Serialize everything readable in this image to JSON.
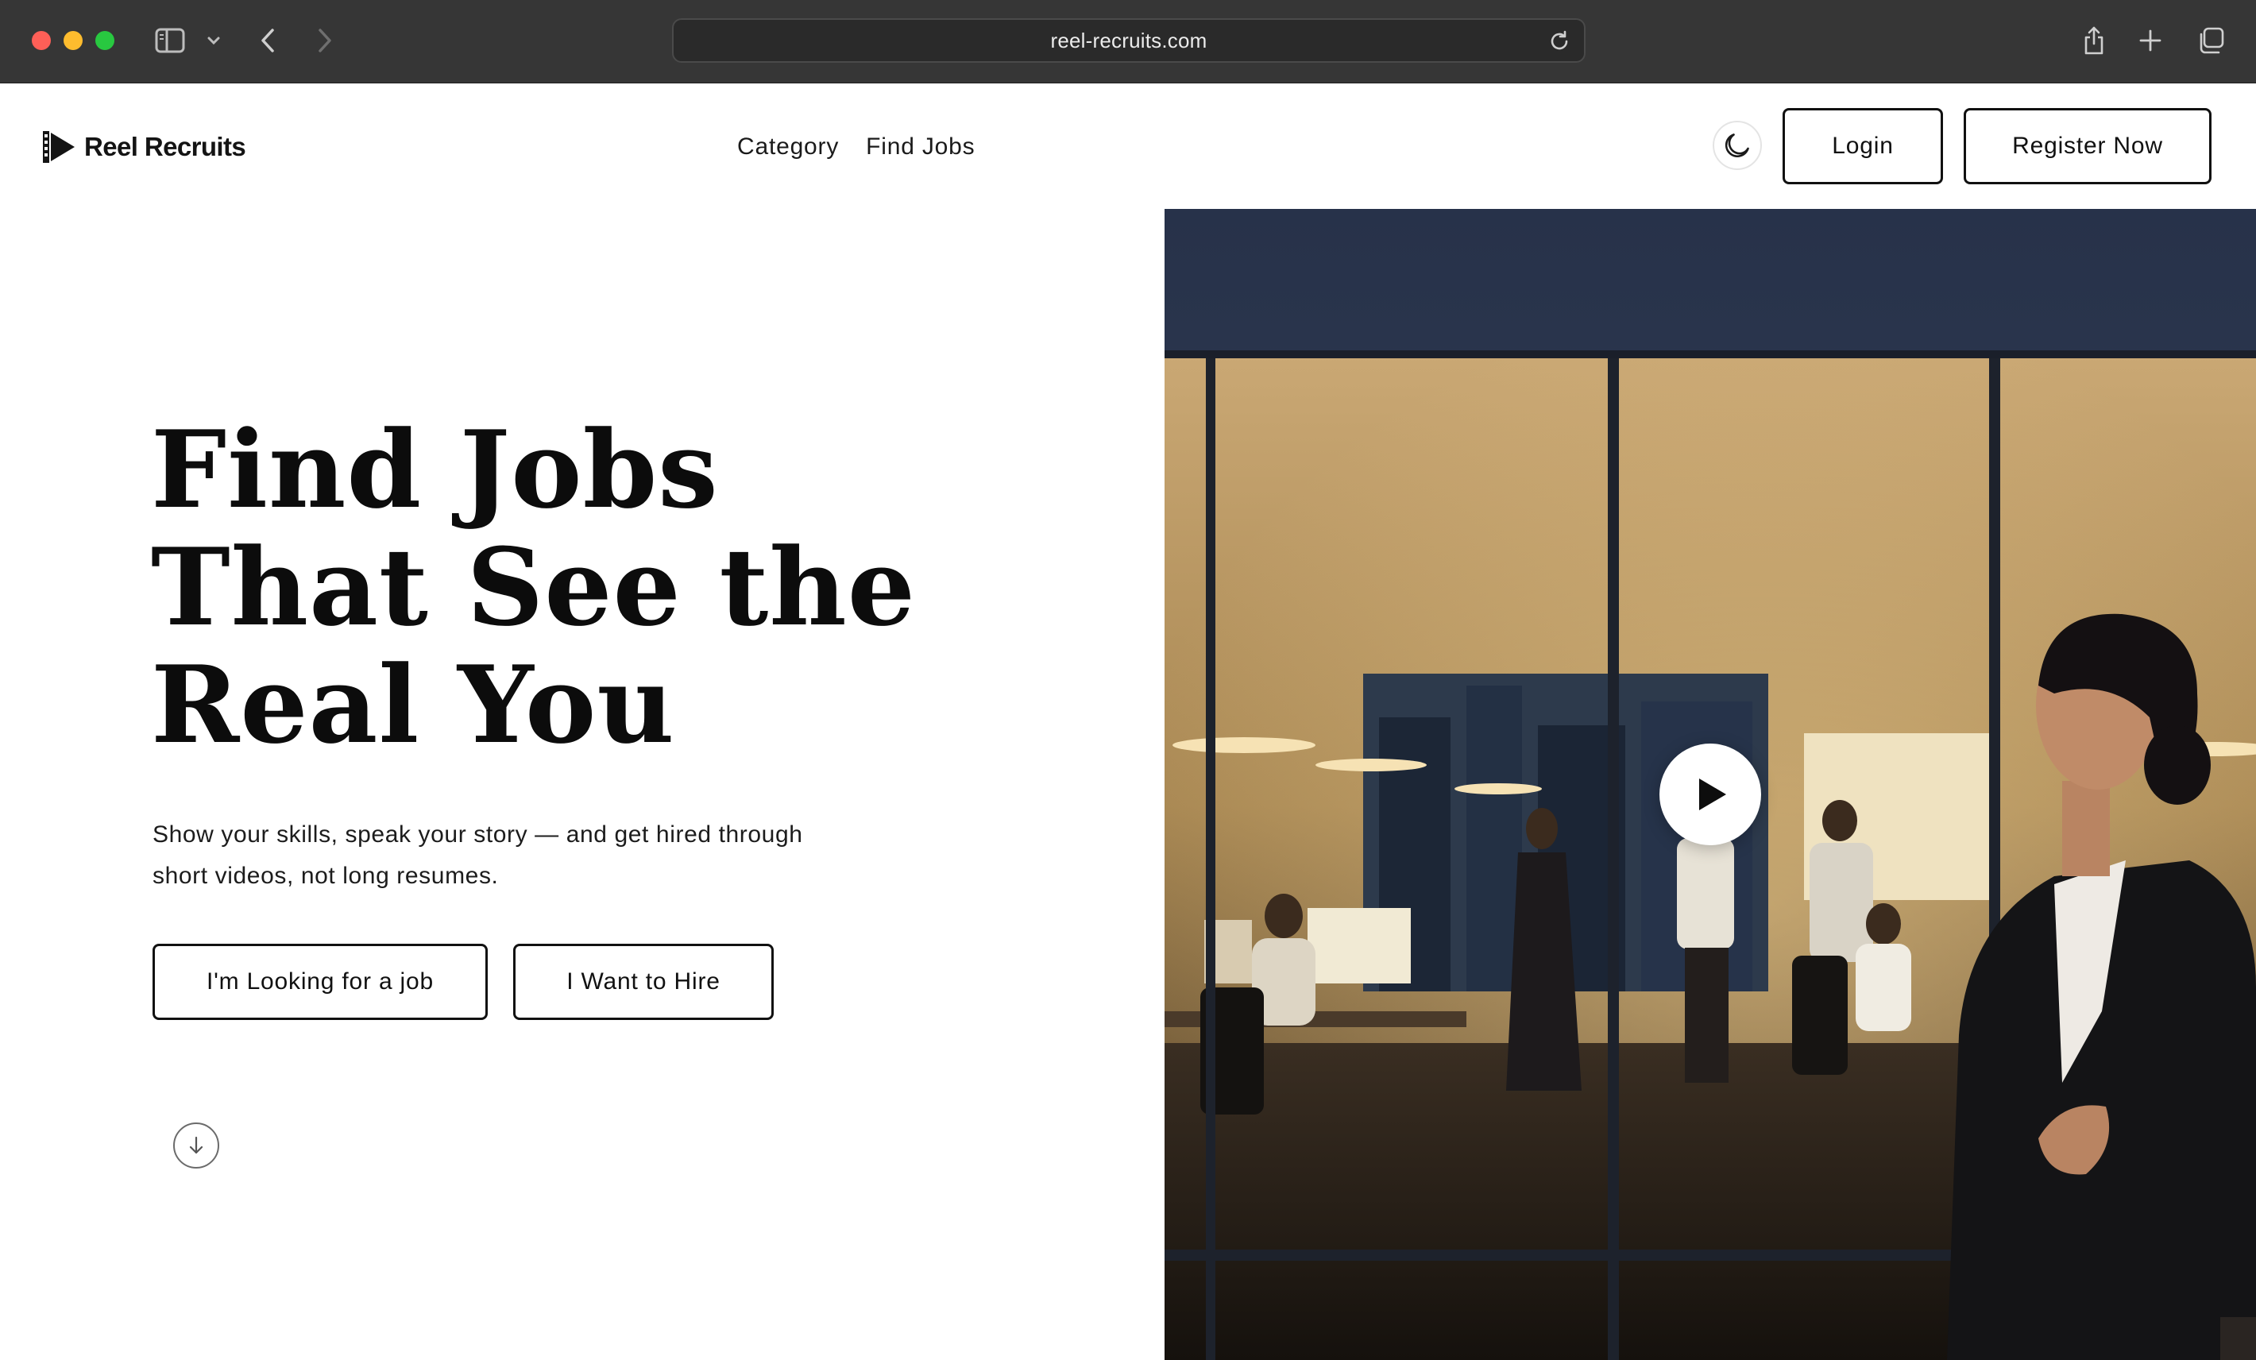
{
  "browser": {
    "url": "reel-recruits.com",
    "icons": {
      "sidebar": "sidebar-icon",
      "back": "chevron-left-icon",
      "forward": "chevron-right-icon",
      "reload": "reload-icon",
      "share": "share-icon",
      "new_tab": "plus-icon",
      "tabs": "tabs-overview-icon"
    }
  },
  "brand": {
    "name": "Reel Recruits"
  },
  "nav": {
    "items": [
      {
        "label": "Category"
      },
      {
        "label": "Find Jobs"
      }
    ]
  },
  "header_actions": {
    "login_label": "Login",
    "register_label": "Register Now",
    "theme_icon": "moon-icon"
  },
  "hero": {
    "title_lines": [
      "Find Jobs",
      "That See the",
      "Real You"
    ],
    "subtitle_lines": [
      "Show your skills, speak your story — and get hired through",
      "short videos, not long resumes."
    ],
    "primary_cta": "I'm Looking for a job",
    "secondary_cta": "I Want to Hire",
    "scroll_icon": "arrow-down-icon"
  },
  "video": {
    "play_icon": "play-icon"
  },
  "colors": {
    "text": "#111111",
    "chrome": "#363636",
    "accent": "#000000"
  }
}
